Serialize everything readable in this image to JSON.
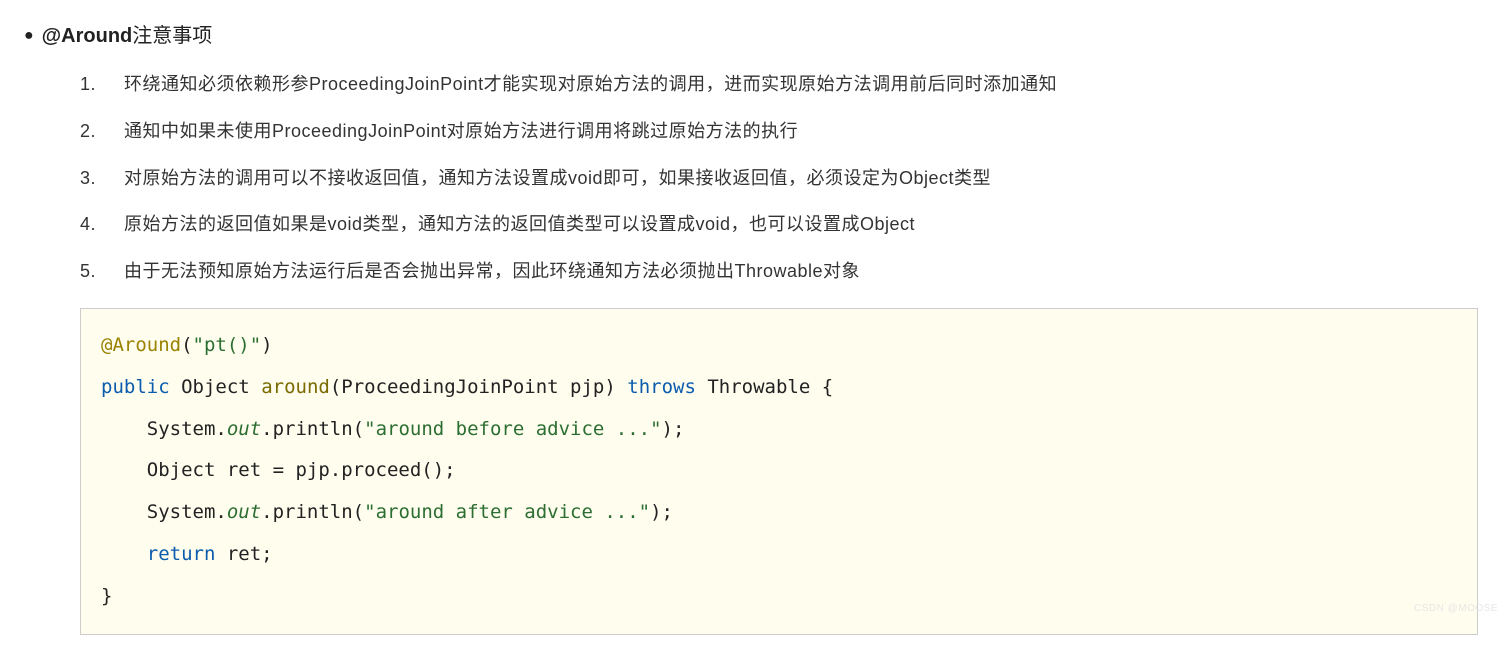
{
  "heading": {
    "bold": "@Around",
    "rest": "注意事项"
  },
  "notes": [
    "环绕通知必须依赖形参ProceedingJoinPoint才能实现对原始方法的调用，进而实现原始方法调用前后同时添加通知",
    "通知中如果未使用ProceedingJoinPoint对原始方法进行调用将跳过原始方法的执行",
    "对原始方法的调用可以不接收返回值，通知方法设置成void即可，如果接收返回值，必须设定为Object类型",
    "原始方法的返回值如果是void类型，通知方法的返回值类型可以设置成void，也可以设置成Object",
    "由于无法预知原始方法运行后是否会抛出异常，因此环绕通知方法必须抛出Throwable对象"
  ],
  "code": {
    "line1": {
      "annotation": "@Around",
      "paren_open": "(",
      "arg": "\"pt()\"",
      "paren_close": ")"
    },
    "line2": {
      "kw_public": "public",
      "ret_type": "Object",
      "method": "around",
      "params": "(ProceedingJoinPoint pjp)",
      "kw_throws": "throws",
      "throwable": "Throwable {"
    },
    "line3": {
      "indent": "    ",
      "prefix": "System.",
      "field": "out",
      "after": ".println(",
      "str": "\"around before advice ...\"",
      "close": ");"
    },
    "line4": {
      "indent": "    ",
      "text": "Object ret = pjp.proceed();"
    },
    "line5": {
      "indent": "    ",
      "prefix": "System.",
      "field": "out",
      "after": ".println(",
      "str": "\"around after advice ...\"",
      "close": ");"
    },
    "line6": {
      "indent": "    ",
      "kw": "return",
      "rest": " ret;"
    },
    "line7": {
      "text": "}"
    }
  },
  "watermark": "CSDN @MOOSE"
}
